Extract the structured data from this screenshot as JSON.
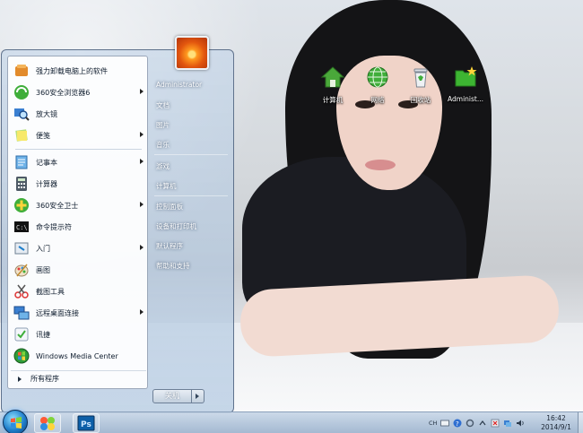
{
  "desktop": {
    "icons": [
      {
        "label": "计算机",
        "icon": "computer-icon"
      },
      {
        "label": "网络",
        "icon": "network-icon"
      },
      {
        "label": "回收站",
        "icon": "recycle-bin-icon"
      },
      {
        "label": "Administ...",
        "icon": "user-folder-icon"
      }
    ]
  },
  "start_menu": {
    "programs": [
      {
        "label": "强力卸载电脑上的软件",
        "icon": "uninstall-icon",
        "submenu": false
      },
      {
        "label": "360安全浏览器6",
        "icon": "browser-360-icon",
        "submenu": true
      },
      {
        "label": "放大镜",
        "icon": "magnifier-icon",
        "submenu": false
      },
      {
        "label": "便笺",
        "icon": "sticky-notes-icon",
        "submenu": true
      },
      {
        "label": "记事本",
        "icon": "notepad-icon",
        "submenu": true
      },
      {
        "label": "计算器",
        "icon": "calculator-icon",
        "submenu": false
      },
      {
        "label": "360安全卫士",
        "icon": "security-360-icon",
        "submenu": true
      },
      {
        "label": "命令提示符",
        "icon": "command-prompt-icon",
        "submenu": false
      },
      {
        "label": "入门",
        "icon": "getting-started-icon",
        "submenu": true
      },
      {
        "label": "画图",
        "icon": "paint-icon",
        "submenu": false
      },
      {
        "label": "截图工具",
        "icon": "snipping-tool-icon",
        "submenu": false
      },
      {
        "label": "远程桌面连接",
        "icon": "remote-desktop-icon",
        "submenu": true
      },
      {
        "label": "讯捷",
        "icon": "xunjie-icon",
        "submenu": false
      },
      {
        "label": "Windows Media Center",
        "icon": "media-center-icon",
        "submenu": false
      }
    ],
    "all_programs": "所有程序",
    "right_pane": [
      "Administrator",
      "文档",
      "图片",
      "音乐",
      "游戏",
      "计算机",
      "控制面板",
      "设备和打印机",
      "默认程序",
      "帮助和支持"
    ],
    "shutdown_label": "关机"
  },
  "taskbar": {
    "pinned": [
      {
        "name": "start-orb",
        "icon": "windows-logo-icon"
      },
      {
        "name": "explorer",
        "icon": "explorer-icon"
      },
      {
        "name": "photoshop",
        "icon": "photoshop-icon",
        "label": "Ps"
      }
    ],
    "tray_text": "CH",
    "clock_time": "16:42",
    "clock_date": "2014/9/1"
  },
  "colors": {
    "accent": "#1f7fcc",
    "photoshop_blue": "#0d5fa8",
    "folder_green": "#3db532"
  }
}
